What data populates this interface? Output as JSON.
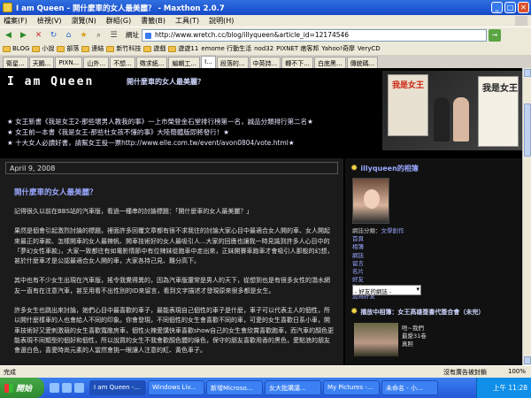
{
  "window": {
    "title": "I am Queen - 開什麼車的女人最美麗？ - Maxthon 2.0.7",
    "min": "_",
    "max": "□",
    "close": "✕"
  },
  "menu": [
    "檔案(F)",
    "檢視(V)",
    "瀏覽(N)",
    "群組(G)",
    "書籤(B)",
    "工具(T)",
    "說明(H)"
  ],
  "toolbar": {
    "address_label": "網址",
    "address_value": "http://www.wretch.cc/blog/illyqueen&article_id=12174546"
  },
  "bookmarks": [
    "BLOG",
    "小說",
    "部落",
    "連結",
    "新竹科技",
    "遊戲",
    "遊遊11",
    "emome 行動生活",
    "nod32",
    "PIXNET 痞客邦",
    "Yahoo!奇摩",
    "VeryCD"
  ],
  "tabs": [
    "衛星...",
    "天鵝...",
    "PIXN...",
    "山外...",
    "不想...",
    "徵求紙...",
    "編輯工...",
    "I...",
    "",
    "",
    "",
    "",
    "段落的...",
    "中英詩...",
    "轉不下...",
    "白底黑...",
    "傳統碼..."
  ],
  "blog": {
    "title": "I am Queen",
    "subtitle": "開什麼車的女人最美麗？",
    "promo1": "★ 女王新書《我是女王2-那些壞男人教我的事》一上市榮登金石堂排行榜第一名，誠品分類排行第二名★",
    "promo2": "★ 女王前一本書《我是女王-那些杜女孩不懂的事》大陸簡體版即將發行！★",
    "promo3": "★ 十大女人必讀好書，請幫女王投一票http://www.elle.com.tw/event/avon0804/vote.html★",
    "book1_title": "我是女王",
    "book2_title": "我是女王"
  },
  "post": {
    "date": "April 9, 2008",
    "title": "開什麼車的女人最美麗？",
    "paragraphs": [
      "記得很久以前在BBS站的汽車版，看過一種串的討論標題：「開什麼車的女人最美麗？」",
      "果然是個會引起激烈討論的標題，裡面許多回覆文章都有很不求我往的討論大家心目中最適合女人開的車、女人開起來最正的車款、怎樣開車的女人最辣帆、開車技術好的女人最吸引人...大家的回應也讓我一時見識到許多人心目中的「夢幻女性車款」，大家一致都往有如電影情節中有位辣妹從跑車中走出來，正妹開賽車跑車才會吸引人那般的幻想，甚於什麼車才是公認最適合女人開的車，大家各持己見、難分高下。",
      "其中也有不少女生出現在汽車版，搖令我覺得異的，因為汽車版還常是男人的天下，從想到也是有很多女性的潛水網友一直有在注意汽車，甚至用看不出性別的ID來留言，看到文字描述才發現原來很多都是女生。",
      "許多女生也跳出來討論，她們心目中最喜歡的車子，最能表現自己個性的車子是什麼，車子可以代表主人的個性，所以開什麼樣車的人也會給人不同的印象。你會發現，不同個性的女生會喜歡不同的車，可愛的女生喜歡日系小車，開車技術好又愛刺激競的女生喜歡寬敞房車，個性火辣愛講快車喜歡show自己的女生會欣賞喜歡跑車，而汽車的顏色更能表現不同類型的個好和個性，所以說買的女生不我會歡顏色體的綠色，保守的朋友喜歡用香的黑色，愛點浪的朋友會選白色，喜愛時尚元素的人當然會挑一眼讓人注意的紅、黃色車子。"
    ]
  },
  "sidebar": {
    "profile_title": "illyqueen的相簿",
    "info_label": "網誌分類：",
    "info_value": "文學創作",
    "links": [
      "首頁",
      "相簿",
      "網誌",
      "留言",
      "名片",
      "好友",
      "影音",
      "加為好友"
    ],
    "friend_select": "- 好友的網誌 -",
    "media_title": "播放中相簿：女王高雄簽書代簽合會（未完）",
    "media_lines": [
      "唔~我們",
      "最愛31卷",
      "真照"
    ]
  },
  "status": {
    "left": "完成",
    "right": "沒有廣告被封鎖",
    "zoom": "100%"
  },
  "taskbar": {
    "start": "開始",
    "items": [
      "I am Queen -...",
      "Windows Liv...",
      "新增Microso...",
      "女大批購議...",
      "My Pictures -...",
      "未命名 - 小..."
    ],
    "clock": "上午 11:28"
  }
}
